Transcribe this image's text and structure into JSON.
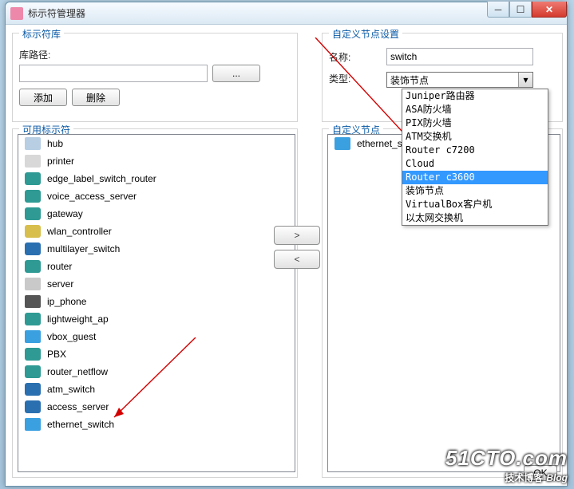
{
  "window": {
    "title": "标示符管理器"
  },
  "left_top": {
    "group_title": "标示符库",
    "path_label": "库路径:",
    "path_value": "",
    "browse_btn": "...",
    "add_btn": "添加",
    "delete_btn": "删除"
  },
  "left_bot": {
    "group_title": "可用标示符",
    "items": [
      {
        "label": "hub",
        "icon": "hub"
      },
      {
        "label": "printer",
        "icon": "printer"
      },
      {
        "label": "edge_label_switch_router",
        "icon": "teal"
      },
      {
        "label": "voice_access_server",
        "icon": "teal"
      },
      {
        "label": "gateway",
        "icon": "teal"
      },
      {
        "label": "wlan_controller",
        "icon": "gold"
      },
      {
        "label": "multilayer_switch",
        "icon": "blue"
      },
      {
        "label": "router",
        "icon": "teal"
      },
      {
        "label": "server",
        "icon": "grey"
      },
      {
        "label": "ip_phone",
        "icon": "phone"
      },
      {
        "label": "lightweight_ap",
        "icon": "teal"
      },
      {
        "label": "vbox_guest",
        "icon": "sw"
      },
      {
        "label": "PBX",
        "icon": "teal"
      },
      {
        "label": "router_netflow",
        "icon": "teal"
      },
      {
        "label": "atm_switch",
        "icon": "blue"
      },
      {
        "label": "access_server",
        "icon": "blue"
      },
      {
        "label": "ethernet_switch",
        "icon": "sw"
      }
    ]
  },
  "right_top": {
    "group_title": "自定义节点设置",
    "name_label": "名称:",
    "name_value": "switch",
    "type_label": "类型:",
    "combo_display": "装饰节点",
    "dropdown_items": [
      "Juniper路由器",
      "ASA防火墙",
      "PIX防火墙",
      "ATM交换机",
      "Router c7200",
      "Cloud",
      "Router c3600",
      "装饰节点",
      "VirtualBox客户机",
      "以太网交换机"
    ],
    "dropdown_selected_index": 6
  },
  "right_bot": {
    "group_title": "自定义节点",
    "items": [
      {
        "label": "ethernet_switch",
        "icon": "sw"
      }
    ]
  },
  "arrows": {
    "right": ">",
    "left": "<"
  },
  "ok_btn": "OK",
  "watermark": {
    "line1": "51CTO.com",
    "line2": "技术博客",
    "line3": "Blog"
  }
}
